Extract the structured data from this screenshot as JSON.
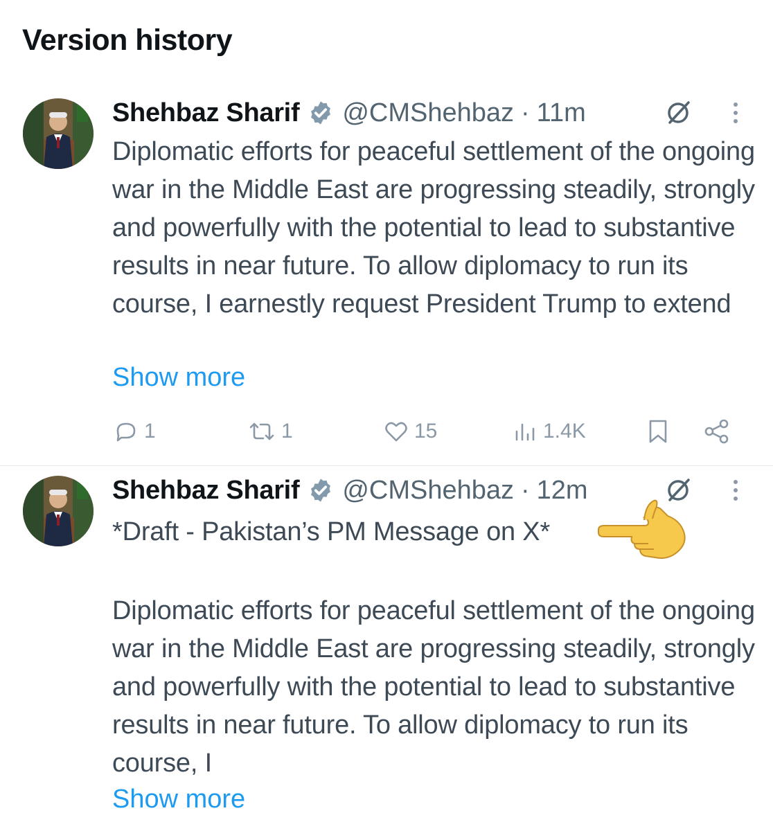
{
  "page": {
    "title": "Version history"
  },
  "tweets": [
    {
      "author": "Shehbaz Sharif",
      "handle": "@CMShehbaz",
      "separator": "·",
      "time": "11m",
      "text": "Diplomatic efforts for peaceful settlement of the ongoing war in the Middle East are progressing steadily, strongly and powerfully with the potential to lead to substantive results in near future. To allow diplomacy to run its course, I earnestly request President Trump to extend",
      "show_more": "Show more",
      "stats": {
        "replies": "1",
        "reposts": "1",
        "likes": "15",
        "views": "1.4K"
      }
    },
    {
      "author": "Shehbaz Sharif",
      "handle": "@CMShehbaz",
      "separator": "·",
      "time": "12m",
      "draft_line": "*Draft - Pakistan’s PM Message on X*",
      "text": "Diplomatic efforts for peaceful settlement of the ongoing war in the Middle East are progressing steadily, strongly and powerfully with the potential to lead to substantive results in near future. To allow diplomacy to run its course, I",
      "show_more": "Show more"
    }
  ],
  "icons": {
    "verified": "verified-badge-icon",
    "edit": "edit-history-icon",
    "more": "more-options-icon",
    "reply": "reply-icon",
    "repost": "repost-icon",
    "like": "like-icon",
    "views": "views-icon",
    "bookmark": "bookmark-icon",
    "share": "share-icon",
    "pointer": "pointing-hand-emoji"
  },
  "colors": {
    "link": "#1d9bf0",
    "secondary_text": "#536471",
    "body_text": "#3d4a56",
    "divider": "#e6e9ec"
  }
}
